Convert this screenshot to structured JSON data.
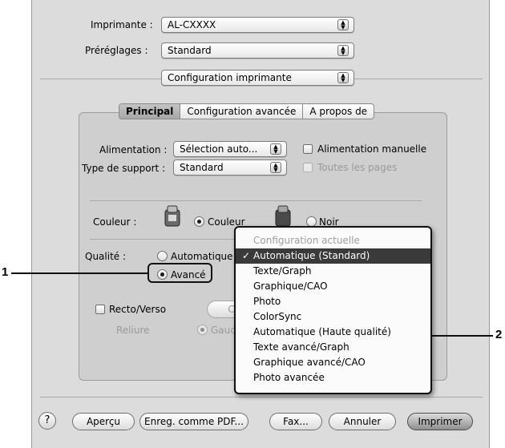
{
  "printer": {
    "label": "Imprimante :",
    "value": "AL-CXXXX"
  },
  "presets": {
    "label": "Préréglages :",
    "value": "Standard"
  },
  "pane": {
    "value": "Configuration imprimante"
  },
  "tabs": [
    {
      "label": "Principal",
      "selected": true
    },
    {
      "label": "Configuration avancée",
      "selected": false
    },
    {
      "label": "A propos de",
      "selected": false
    }
  ],
  "feed": {
    "label": "Alimentation :",
    "value": "Sélection auto...",
    "manual_label": "Alimentation manuelle"
  },
  "media": {
    "label": "Type de support :",
    "value": "Standard",
    "all_pages_label": "Toutes les pages"
  },
  "color": {
    "label": "Couleur :",
    "color_option": "Couleur",
    "mono_option": "Noir"
  },
  "quality": {
    "label": "Qualité :",
    "automatic": "Automatique",
    "advanced": "Avancé"
  },
  "duplex": {
    "label": "Recto/Verso",
    "settings_button": "Conf",
    "binding_label": "Reliure",
    "binding_left": "Gauch"
  },
  "quality_menu": {
    "items": [
      {
        "label": "Configuration actuelle",
        "state": "disabled"
      },
      {
        "label": "Automatique (Standard)",
        "state": "highlighted",
        "check": "✓"
      },
      {
        "label": "Texte/Graph"
      },
      {
        "label": "Graphique/CAO"
      },
      {
        "label": "Photo"
      },
      {
        "label": "ColorSync"
      },
      {
        "label": "Automatique (Haute qualité)"
      },
      {
        "label": "Texte avancé/Graph"
      },
      {
        "label": "Graphique avancé/CAO"
      },
      {
        "label": "Photo avancée"
      }
    ]
  },
  "callouts": {
    "one": "1",
    "two": "2"
  },
  "footer": {
    "help": "?",
    "preview": "Aperçu",
    "save_pdf": "Enreg. comme PDF...",
    "fax": "Fax...",
    "cancel": "Annuler",
    "print": "Imprimer"
  },
  "colors": {
    "window": "#dcdcdc",
    "panel": "#cfcfcf",
    "menu_highlight": "#3a3a3a"
  }
}
